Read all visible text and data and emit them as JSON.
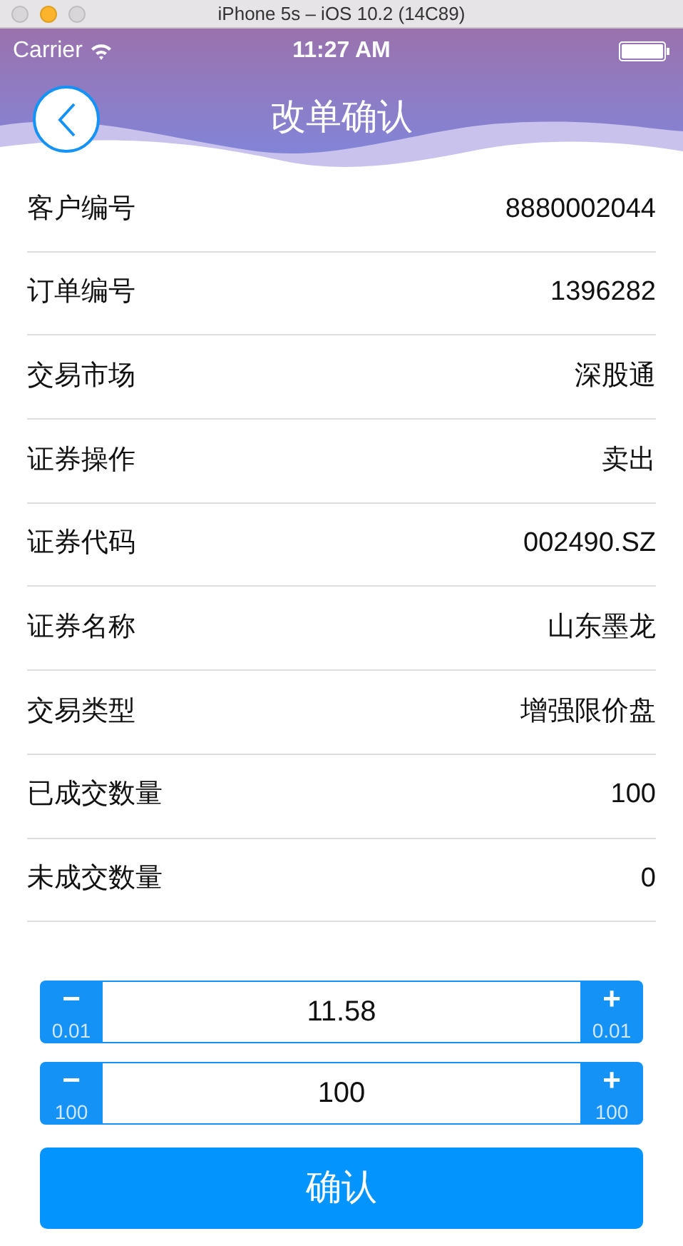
{
  "window": {
    "title": "iPhone 5s – iOS 10.2 (14C89)"
  },
  "status_bar": {
    "carrier": "Carrier",
    "time": "11:27 AM"
  },
  "nav": {
    "title": "改单确认"
  },
  "fields": [
    {
      "label": "客户编号",
      "value": "8880002044"
    },
    {
      "label": "订单编号",
      "value": "1396282"
    },
    {
      "label": "交易市场",
      "value": "深股通"
    },
    {
      "label": "证券操作",
      "value": "卖出"
    },
    {
      "label": "证券代码",
      "value": "002490.SZ"
    },
    {
      "label": "证券名称",
      "value": "山东墨龙"
    },
    {
      "label": "交易类型",
      "value": "增强限价盘"
    },
    {
      "label": "已成交数量",
      "value": "100"
    },
    {
      "label": "未成交数量",
      "value": "0"
    }
  ],
  "steppers": [
    {
      "value": "11.58",
      "minus": "−",
      "minus_step": "0.01",
      "plus": "+",
      "plus_step": "0.01"
    },
    {
      "value": "100",
      "minus": "−",
      "minus_step": "100",
      "plus": "+",
      "plus_step": "100"
    }
  ],
  "confirm_button": "确认"
}
